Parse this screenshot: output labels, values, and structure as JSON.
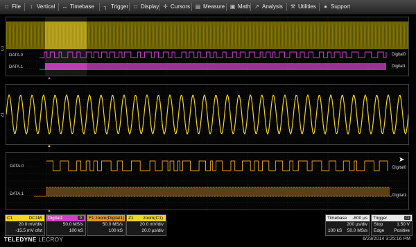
{
  "menu": {
    "items": [
      {
        "label": "File",
        "icon": "□"
      },
      {
        "label": "Vertical",
        "icon": "↕"
      },
      {
        "label": "Timebase",
        "icon": "↔"
      },
      {
        "label": "Trigger",
        "icon": "┐"
      },
      {
        "label": "Display",
        "icon": "□"
      },
      {
        "label": "Cursors",
        "icon": "✛"
      },
      {
        "label": "Measure",
        "icon": "▤"
      },
      {
        "label": "Math",
        "icon": "▣"
      },
      {
        "label": "Analysis",
        "icon": "↗"
      },
      {
        "label": "Utilities",
        "icon": "⚒"
      },
      {
        "label": "Support",
        "icon": "●"
      }
    ]
  },
  "colors": {
    "c1": "#f5d422",
    "digital": "#d040c8",
    "zoom_orange": "#e09a28",
    "grid": "#2a2a2a"
  },
  "grid1": {
    "side_label": "C1",
    "data0": "DATA.0",
    "data1": "DATA.1",
    "tag0": "Digital0",
    "tag1": "Digital1"
  },
  "grid2": {
    "side_label": "Z1"
  },
  "grid3": {
    "data0": "DATA.0",
    "data1": "DATA.1",
    "tag0": "Digital0",
    "tag1": "Digital1"
  },
  "descriptors": {
    "c1": {
      "name": "C1",
      "sub": "DC1M",
      "row1": "20.0 mV/div",
      "row2": "-15.5 mV ofst"
    },
    "digital1": {
      "name": "Digital1",
      "row1": "50.0 MS/s",
      "row2": "100 kS"
    },
    "f1": {
      "name": "F1 zoom(Digital1)",
      "row1": "50.0 MS/s",
      "row2": "100 kS"
    },
    "z1": {
      "name": "Z1",
      "sub": "zoom(C1)",
      "row1": "20.0 mV/div",
      "row2": "20.0 µs/div"
    },
    "timebase": {
      "name": "Timebase",
      "value": "-800 µs",
      "row1_r": "200 µs/div",
      "row2_l": "100 kS",
      "row2_r": "50.0 MS/s"
    },
    "trigger": {
      "name": "Trigger",
      "row1_l": "Stop",
      "row1_r": "1.50 V",
      "row2_l": "Edge",
      "row2_r": "Positive"
    }
  },
  "footer": {
    "brand_bold": "TELEDYNE",
    "brand_rest": "LECROY",
    "datetime": "6/23/2014 3:25:16 PM"
  }
}
